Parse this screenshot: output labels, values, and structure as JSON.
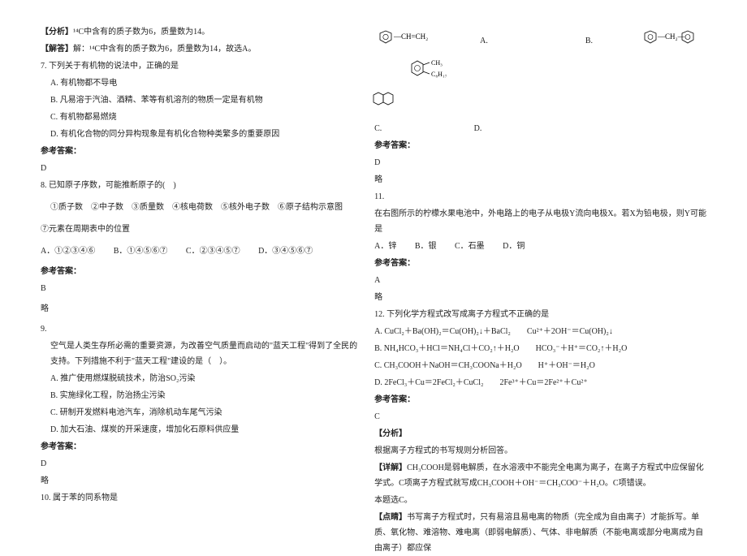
{
  "left": {
    "analysis_label": "【分析】",
    "analysis_text": "¹⁴C中含有的质子数为6，质量数为14。",
    "answer_label": "【解答】",
    "answer_text": "解：¹⁴C中含有的质子数为6，质量数为14，故选A。",
    "q7_stem": "7. 下列关于有机物的说法中，正确的是",
    "q7_a": "A. 有机物都不导电",
    "q7_b": "B. 凡易溶于汽油、酒精、苯等有机溶剂的物质一定是有机物",
    "q7_c": "C. 有机物都易燃烧",
    "q7_d": "D. 有机化合物的同分异构现象是有机化合物种类繁多的重要原因",
    "ref_label": "参考答案：",
    "q7_ans": "D",
    "q8_stem": "8. 已知原子序数，可能推断原子的(　)",
    "q8_items": "①质子数　②中子数　③质量数　④核电荷数　⑤核外电子数　⑥原子结构示意图",
    "q8_items2": "⑦元素在周期表中的位置",
    "q8_a": "A．①②③④⑥",
    "q8_b": "B．①④⑤⑥⑦",
    "q8_c": "C．②③④⑤⑦",
    "q8_d": "D．③④⑤⑥⑦",
    "q8_ans": "B",
    "lue": "略",
    "q9_num": "9.",
    "q9_p1": "空气是人类生存所必需的重要资源，为改善空气质量而启动的\"蓝天工程\"得到了全民的支持。下列措施不利于\"蓝天工程\"建设的是（　）。",
    "q9_a": "A. 推广使用燃煤脱硫技术，防治SO₂污染",
    "q9_b": "B. 实施绿化工程，防治扬尘污染",
    "q9_c": "C. 研制开发燃料电池汽车，消除机动车尾气污染",
    "q9_d": "D. 加大石油、煤炭的开采速度，增加化石原料供应量",
    "q9_ans": "D",
    "q10_stem": "10. 属于苯的同系物是"
  },
  "right": {
    "opt_a": "A.",
    "opt_b": "B.",
    "opt_c": "C.",
    "opt_d": "D.",
    "ref_label": "参考答案：",
    "q10_ans": "D",
    "lue": "略",
    "q11_num": "11.",
    "q11_stem": "在右图所示的柠檬水果电池中，外电路上的电子从电极Y流向电极X。若X为铅电极，则Y可能是",
    "q11_a": "A．锌",
    "q11_b": "B．银",
    "q11_c": "C．石墨",
    "q11_d": "D．铜",
    "q11_ans": "A",
    "q12_stem": "12. 下列化学方程式改写成离子方程式不正确的是",
    "q12_a": "A. CuCl₂＋Ba(OH)₂＝Cu(OH)₂↓＋BaCl₂　　Cu²⁺＋2OH⁻＝Cu(OH)₂↓",
    "q12_b": "B. NH₄HCO₃＋HCl＝NH₄Cl＋CO₂↑＋H₂O　　HCO₃⁻＋H⁺＝CO₂↑＋H₂O",
    "q12_c": "C. CH₃COOH＋NaOH＝CH₃COONa＋H₂O　　H⁺＋OH⁻＝H₂O",
    "q12_d": "D. 2FeCl₃＋Cu＝2FeCl₂＋CuCl₂　　2Fe³⁺＋Cu＝2Fe²⁺＋Cu²⁺",
    "q12_ans": "C",
    "analysis_label": "【分析】",
    "analysis_text": "根据离子方程式的书写规则分析回答。",
    "detail_label": "【详解】",
    "detail_text": "CH₃COOH是弱电解质，在水溶液中不能完全电离为离子，在离子方程式中应保留化学式。C项离子方程式就写成CH₃COOH＋OH⁻＝CH₃COO⁻＋H₂O。C项错误。",
    "this_choose": "本题选C。",
    "tip_label": "【点睛】",
    "tip_text": "书写离子方程式时，只有易溶且易电离的物质（完全成为自由离子）才能拆写。单质、氧化物、难溶物、难电离（即弱电解质）、气体、非电解质（不能电离或部分电离成为自由离子）都应保"
  }
}
